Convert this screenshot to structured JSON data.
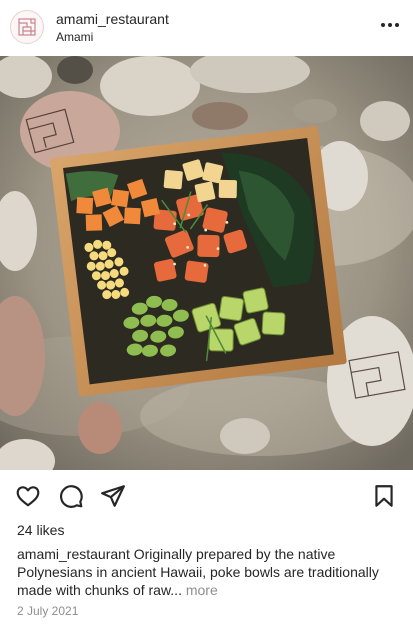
{
  "post": {
    "username": "amami_restaurant",
    "location": "Amami",
    "likes": "24 likes",
    "caption_user": "amami_restaurant",
    "caption_text": "Originally prepared by the native Polynesians in ancient Hawaii, poke bowls are traditionally made with chunks of raw...",
    "more_label": "more",
    "date": "2 July 2021"
  },
  "icons": {
    "avatar": "restaurant-logo",
    "options": "more-options-icon",
    "like": "heart-icon",
    "comment": "comment-icon",
    "share": "share-icon",
    "save": "bookmark-icon"
  },
  "colors": {
    "text": "#262626",
    "secondary_text": "#8e8e8e",
    "logo": "#c9858e"
  }
}
